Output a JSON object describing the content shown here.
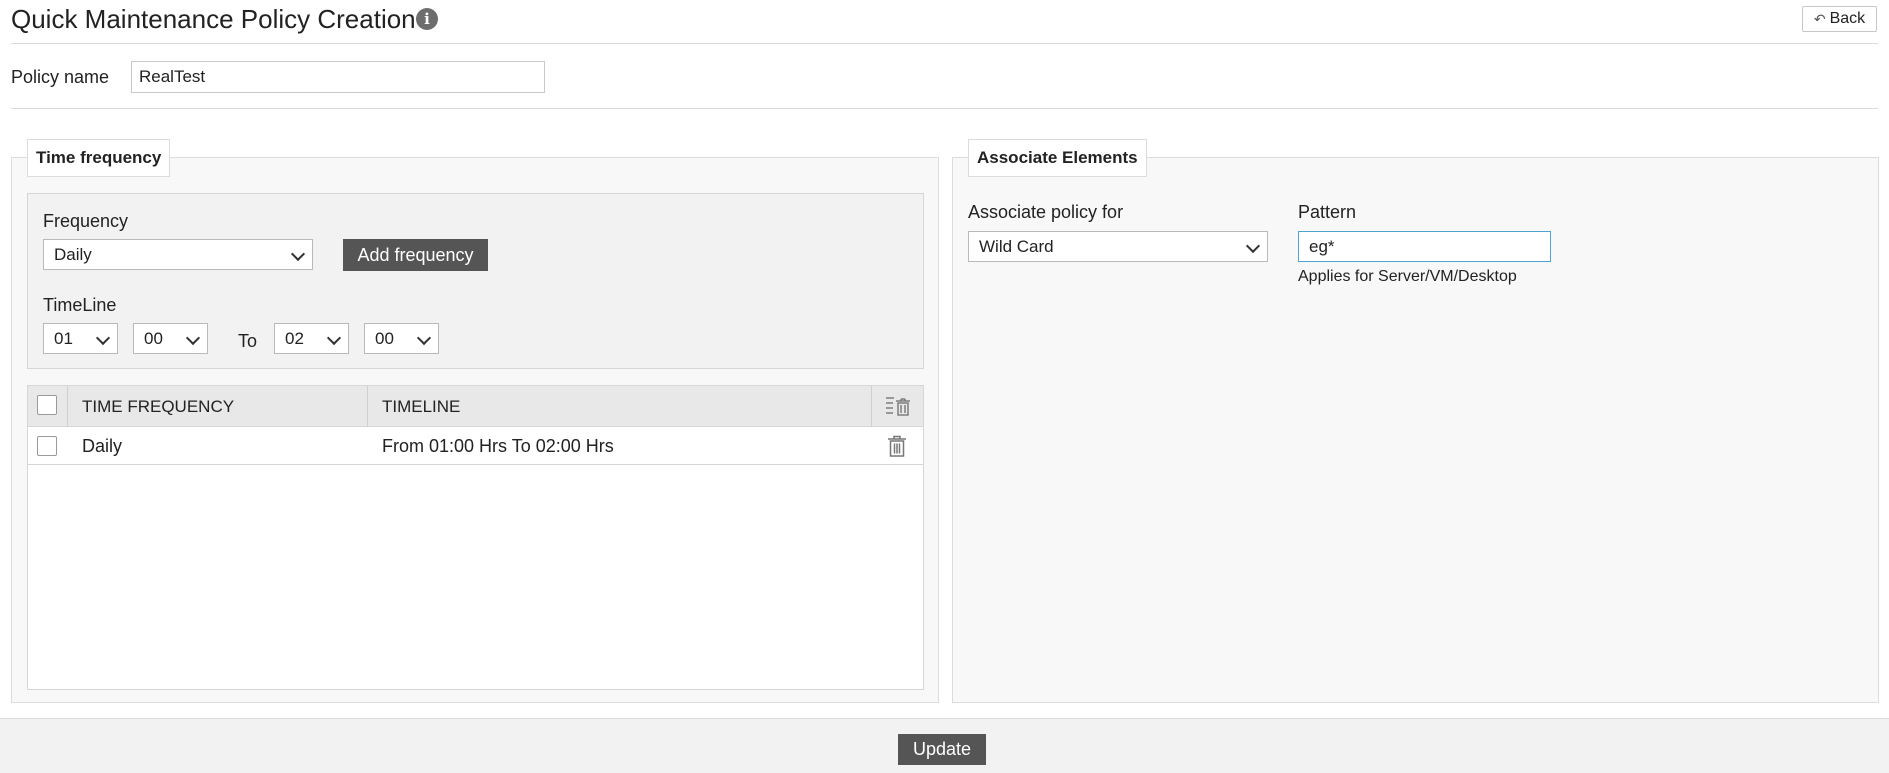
{
  "header": {
    "title": "Quick Maintenance Policy Creation",
    "info_icon": "i",
    "back_label": "Back"
  },
  "policy": {
    "label": "Policy name",
    "value": "RealTest"
  },
  "time_frequency": {
    "legend": "Time frequency",
    "frequency_label": "Frequency",
    "frequency_value": "Daily",
    "add_button": "Add frequency",
    "timeline_label": "TimeLine",
    "from_hour": "01",
    "from_minute": "00",
    "to_label": "To",
    "to_hour": "02",
    "to_minute": "00"
  },
  "table": {
    "columns": [
      "TIME FREQUENCY",
      "TIMELINE"
    ],
    "rows": [
      {
        "frequency": "Daily",
        "timeline": "From 01:00 Hrs To 02:00 Hrs"
      }
    ]
  },
  "associate": {
    "legend": "Associate Elements",
    "for_label": "Associate policy for",
    "for_value": "Wild Card",
    "pattern_label": "Pattern",
    "pattern_value": "eg*",
    "pattern_hint": "Applies for Server/VM/Desktop"
  },
  "footer": {
    "update_label": "Update"
  },
  "colors": {
    "dark_button": "#555555",
    "panel_bg": "#f8f8f8",
    "focus_border": "#4fa3d1"
  }
}
